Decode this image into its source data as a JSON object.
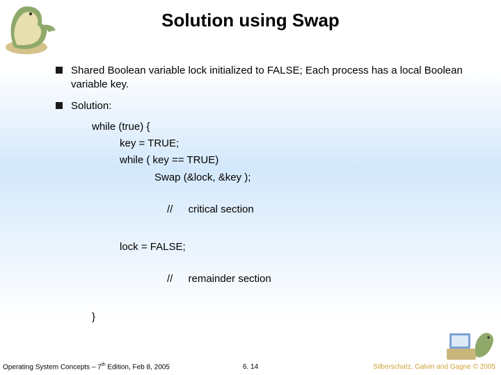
{
  "title": "Solution using Swap",
  "bullets": {
    "item0": "Shared Boolean variable lock initialized to FALSE; Each process has a local Boolean variable key.",
    "item1": "Solution:"
  },
  "code": {
    "l0": "while (true)  {",
    "l1": "key = TRUE;",
    "l2": "while ( key == TRUE)",
    "l3": "Swap (&lock, &key );",
    "c1_slash": "//",
    "c1_text": "critical section",
    "l4": "lock = FALSE;",
    "c2_slash": "//",
    "c2_text": "remainder section",
    "l5": "}"
  },
  "footer": {
    "left_prefix": "Operating System Concepts – 7",
    "left_sup": "th",
    "left_suffix": " Edition, Feb 8, 2005",
    "mid": "6. 14",
    "right_prefix": "Silberschatz, Galvin and Gagne ",
    "right_sym": "©",
    "right_year": " 2005"
  },
  "icons": {
    "dino_top": "dinosaur-mascot",
    "dino_bot": "dinosaur-on-computer"
  }
}
